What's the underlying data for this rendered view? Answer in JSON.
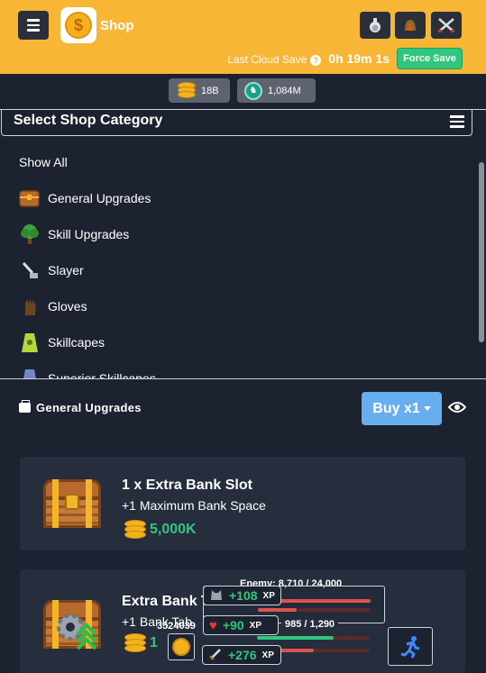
{
  "header": {
    "title": "Shop",
    "cloud_label": "Last Cloud Save",
    "cloud_time": "0h 19m 1s",
    "force_save": "Force Save",
    "colors": {
      "header_bg": "#f8b636",
      "force_save_bg": "#30c77d"
    }
  },
  "currency": {
    "gp": "18B",
    "slayer_coins": "1,084M"
  },
  "categories": {
    "title": "Select Shop Category",
    "show_all": "Show All",
    "items": [
      {
        "label": "General Upgrades",
        "icon": "treasure-chest-icon"
      },
      {
        "label": "Skill Upgrades",
        "icon": "tree-icon"
      },
      {
        "label": "Slayer",
        "icon": "slayer-sword-icon"
      },
      {
        "label": "Gloves",
        "icon": "glove-icon"
      },
      {
        "label": "Skillcapes",
        "icon": "skillcape-icon"
      },
      {
        "label": "Superior Skillcapes",
        "icon": "superior-cape-icon"
      }
    ]
  },
  "section": {
    "title": "General Upgrades",
    "buy_label": "Buy x1"
  },
  "cards": [
    {
      "title": "1 x Extra Bank Slot",
      "desc": "+1 Maximum Bank Space",
      "price": "5,000K"
    },
    {
      "title": "Extra Bank T",
      "desc": "+1 Bank Tab",
      "price": "1"
    }
  ],
  "overlay": {
    "enemy_hp": "Enemy: 8,710 / 24,000",
    "player_hp": "985 / 1,290",
    "counter": "3524039",
    "xp": [
      {
        "value": "+108",
        "unit": "XP",
        "icon": "wolf-icon"
      },
      {
        "value": "+90",
        "unit": "XP",
        "icon": "heart-icon"
      },
      {
        "value": "+276",
        "unit": "XP",
        "icon": "sword-icon"
      }
    ]
  }
}
